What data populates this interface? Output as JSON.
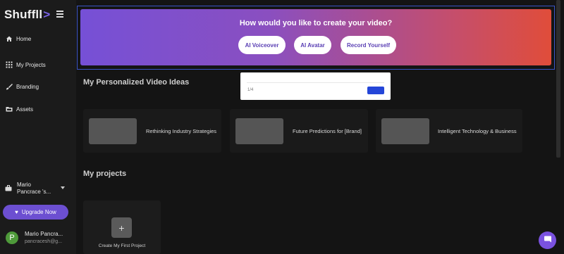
{
  "sidebar": {
    "logo": "Shuffll",
    "logo_mark": ">",
    "items": [
      {
        "label": "Home",
        "icon": "home-icon"
      },
      {
        "label": "My Projects",
        "icon": "grid-icon"
      },
      {
        "label": "Branding",
        "icon": "brush-icon"
      },
      {
        "label": "Assets",
        "icon": "folder-icon"
      }
    ],
    "workspace": "Mario Pancrace 's...",
    "upgrade_label": "Upgrade Now",
    "user": {
      "initial": "P",
      "name": "Mario Pancra...",
      "email": "pancracesh@g..."
    }
  },
  "hero": {
    "title": "How would you like to create your video?",
    "buttons": [
      "AI Voiceover",
      "AI Avatar",
      "Record Yourself"
    ]
  },
  "tour_popup": {
    "step": "1/4"
  },
  "ideas_section": {
    "title": "My Personalized Video Ideas",
    "cards": [
      "Rethinking Industry Strategies",
      "Future Predictions for [Brand]",
      "Intelligent Technology & Business"
    ]
  },
  "projects_section": {
    "title": "My projects",
    "create_label": "Create My First Project"
  },
  "colors": {
    "accent": "#6c4fd1",
    "hero_gradient_start": "#7650d6",
    "hero_gradient_end": "#e04d3a",
    "tour_next": "#2446d8"
  }
}
